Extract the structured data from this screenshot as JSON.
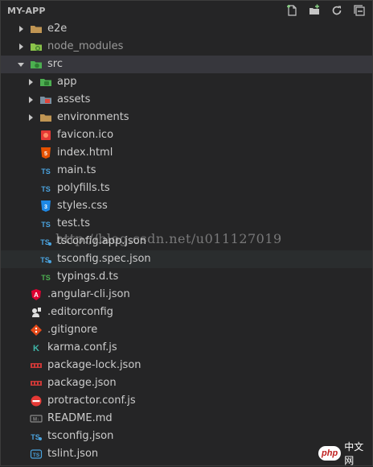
{
  "explorer": {
    "title": "MY-APP",
    "actions": [
      {
        "name": "new-file-icon"
      },
      {
        "name": "new-folder-icon"
      },
      {
        "name": "refresh-icon"
      },
      {
        "name": "collapse-all-icon"
      }
    ]
  },
  "tree": [
    {
      "label": "e2e",
      "type": "folder",
      "expanded": false,
      "depth": 0,
      "icon": "folder-icon"
    },
    {
      "label": "node_modules",
      "type": "folder",
      "expanded": false,
      "depth": 0,
      "icon": "node-folder-icon",
      "dim": true
    },
    {
      "label": "src",
      "type": "folder",
      "expanded": true,
      "depth": 0,
      "icon": "src-folder-icon",
      "selected": true
    },
    {
      "label": "app",
      "type": "folder",
      "expanded": false,
      "depth": 1,
      "icon": "app-folder-icon"
    },
    {
      "label": "assets",
      "type": "folder",
      "expanded": false,
      "depth": 1,
      "icon": "assets-folder-icon"
    },
    {
      "label": "environments",
      "type": "folder",
      "expanded": false,
      "depth": 1,
      "icon": "folder-icon"
    },
    {
      "label": "favicon.ico",
      "type": "file",
      "depth": 1,
      "icon": "image-file-icon"
    },
    {
      "label": "index.html",
      "type": "file",
      "depth": 1,
      "icon": "html-file-icon"
    },
    {
      "label": "main.ts",
      "type": "file",
      "depth": 1,
      "icon": "ts-file-icon"
    },
    {
      "label": "polyfills.ts",
      "type": "file",
      "depth": 1,
      "icon": "ts-file-icon"
    },
    {
      "label": "styles.css",
      "type": "file",
      "depth": 1,
      "icon": "css-file-icon"
    },
    {
      "label": "test.ts",
      "type": "file",
      "depth": 1,
      "icon": "ts-file-icon"
    },
    {
      "label": "tsconfig.app.json",
      "type": "file",
      "depth": 1,
      "icon": "tsconfig-file-icon"
    },
    {
      "label": "tsconfig.spec.json",
      "type": "file",
      "depth": 1,
      "icon": "tsconfig-file-icon",
      "hover": true
    },
    {
      "label": "typings.d.ts",
      "type": "file",
      "depth": 1,
      "icon": "dts-file-icon"
    },
    {
      "label": ".angular-cli.json",
      "type": "file",
      "depth": 0,
      "icon": "angular-file-icon"
    },
    {
      "label": ".editorconfig",
      "type": "file",
      "depth": 0,
      "icon": "editorconfig-file-icon"
    },
    {
      "label": ".gitignore",
      "type": "file",
      "depth": 0,
      "icon": "git-file-icon"
    },
    {
      "label": "karma.conf.js",
      "type": "file",
      "depth": 0,
      "icon": "karma-file-icon"
    },
    {
      "label": "package-lock.json",
      "type": "file",
      "depth": 0,
      "icon": "npm-file-icon"
    },
    {
      "label": "package.json",
      "type": "file",
      "depth": 0,
      "icon": "npm-file-icon"
    },
    {
      "label": "protractor.conf.js",
      "type": "file",
      "depth": 0,
      "icon": "protractor-file-icon"
    },
    {
      "label": "README.md",
      "type": "file",
      "depth": 0,
      "icon": "markdown-file-icon"
    },
    {
      "label": "tsconfig.json",
      "type": "file",
      "depth": 0,
      "icon": "tsconfig-file-icon"
    },
    {
      "label": "tslint.json",
      "type": "file",
      "depth": 0,
      "icon": "tslint-file-icon"
    }
  ],
  "overlays": {
    "watermark": "http://blog.csdn.net/u011127019",
    "badge_php": "php",
    "badge_site": "中文网"
  }
}
